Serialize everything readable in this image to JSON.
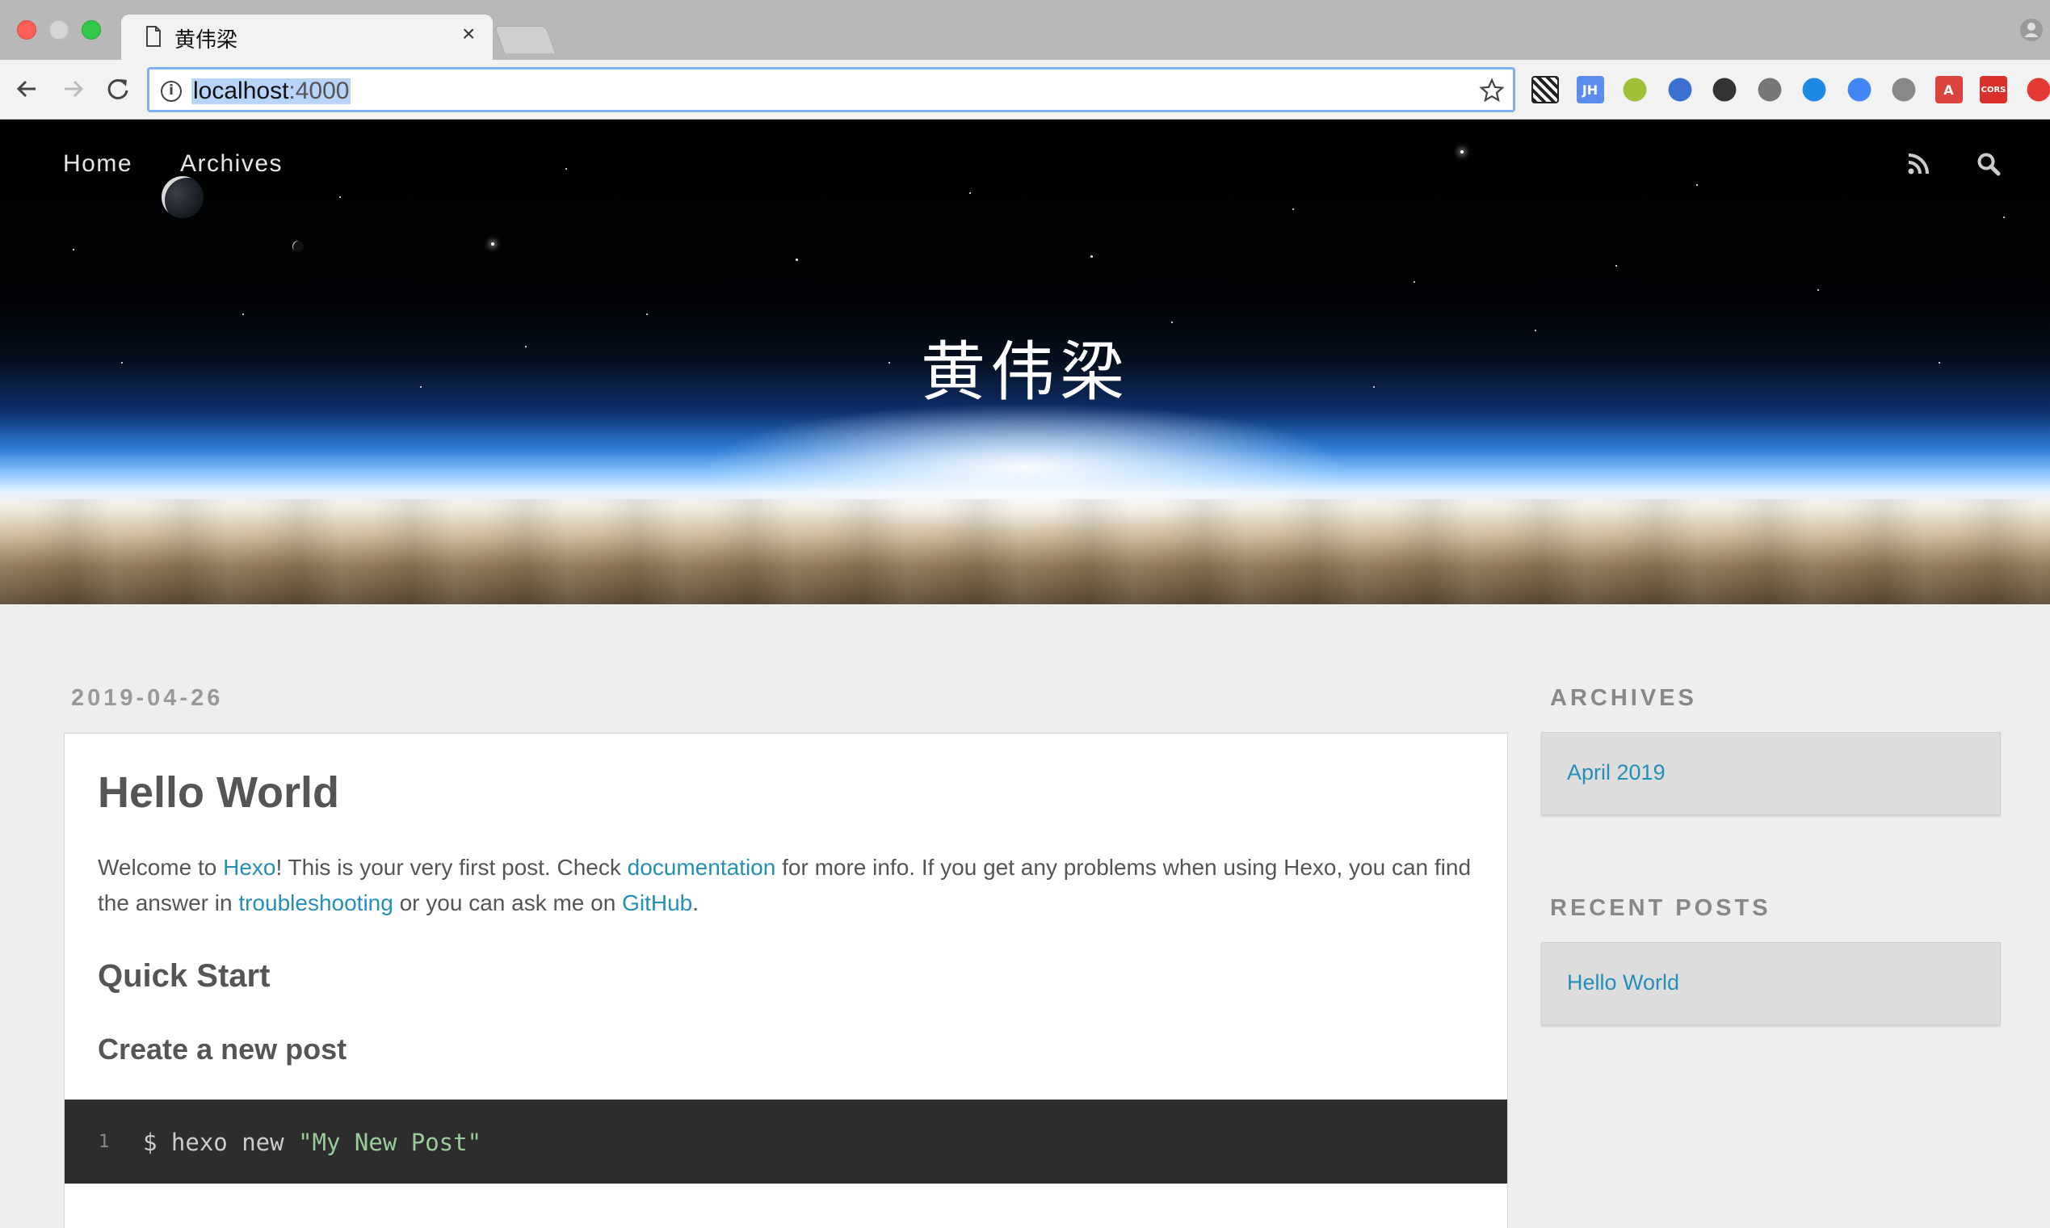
{
  "browser": {
    "tab_title": "黄伟梁",
    "tab_close": "×",
    "url_host": "localhost",
    "url_port": ":4000",
    "extensions": [
      {
        "name": "qr-code-extension-icon",
        "label": "",
        "color": "#ffffff"
      },
      {
        "name": "jh-extension-icon",
        "label": "JH",
        "color": "#5b8dee"
      },
      {
        "name": "android-extension-icon",
        "label": "",
        "color": "#9fc037"
      },
      {
        "name": "globe-extension-icon",
        "label": "",
        "color": "#3b6fd1"
      },
      {
        "name": "coffee-extension-icon",
        "label": "",
        "color": "#333333"
      },
      {
        "name": "cast-extension-icon",
        "label": "",
        "color": "#777777"
      },
      {
        "name": "pocket-extension-icon",
        "label": "",
        "color": "#1e88e5"
      },
      {
        "name": "translate-extension-icon",
        "label": "",
        "color": "#4285f4"
      },
      {
        "name": "camera-extension-icon",
        "label": "",
        "color": "#888888"
      },
      {
        "name": "a-extension-icon",
        "label": "A",
        "color": "#d9453c"
      },
      {
        "name": "cors-extension-icon",
        "label": "CORS",
        "color": "#d9302c"
      },
      {
        "name": "upload-extension-icon",
        "label": "",
        "color": "#e53935"
      }
    ]
  },
  "site": {
    "nav": {
      "home": "Home",
      "archives": "Archives"
    },
    "title": "黄伟梁"
  },
  "post": {
    "date": "2019-04-26",
    "title": "Hello World",
    "intro": {
      "t1": "Welcome to ",
      "link_hexo": "Hexo",
      "t2": "! This is your very first post. Check ",
      "link_docs": "documentation",
      "t3": " for more info. If you get any problems when using Hexo, you can find the answer in ",
      "link_trouble": "troubleshooting",
      "t4": " or you can ask me on ",
      "link_github": "GitHub",
      "t5": "."
    },
    "h2": "Quick Start",
    "h3": "Create a new post",
    "code": {
      "line_no": "1",
      "cmd": "$ hexo new ",
      "arg": "\"My New Post\""
    }
  },
  "sidebar": {
    "archives_title": "ARCHIVES",
    "archives_item": "April 2019",
    "recent_title": "RECENT POSTS",
    "recent_item": "Hello World"
  },
  "colors": {
    "link": "#258fb8",
    "text": "#555555",
    "page_bg": "#eeeeee"
  }
}
